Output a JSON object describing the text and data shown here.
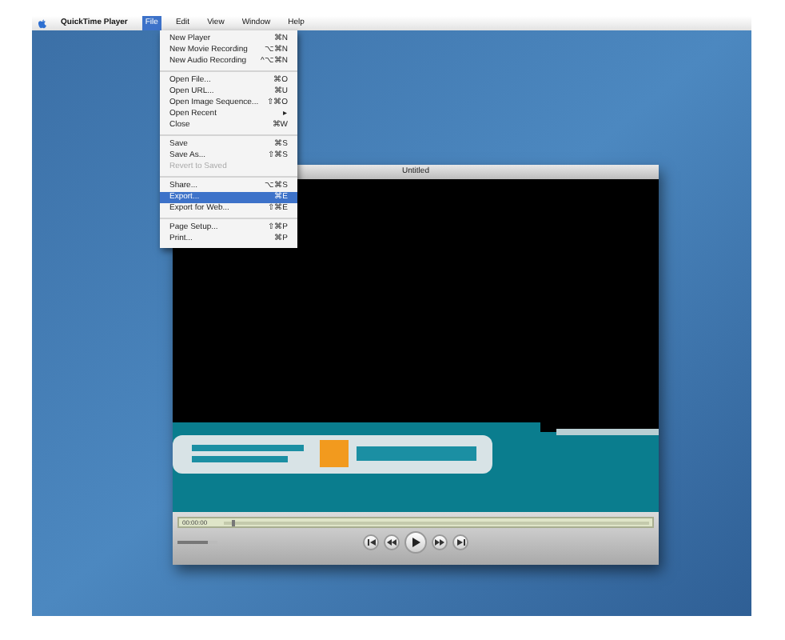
{
  "menu_bar": {
    "items": [
      {
        "kind": "app",
        "label": "QuickTime Player",
        "selected": false
      },
      {
        "kind": "menu",
        "label": "File",
        "selected": true
      },
      {
        "kind": "menu",
        "label": "Edit",
        "selected": false
      },
      {
        "kind": "menu",
        "label": "View",
        "selected": false
      },
      {
        "kind": "menu",
        "label": "Window",
        "selected": false
      },
      {
        "kind": "menu",
        "label": "Help",
        "selected": false
      }
    ]
  },
  "file_menu": {
    "items": [
      {
        "kind": "item",
        "label": "New Player",
        "shortcut": "⌘N",
        "disabled": false,
        "selected": false
      },
      {
        "kind": "item",
        "label": "New Movie Recording",
        "shortcut": "⌥⌘N",
        "disabled": false,
        "selected": false
      },
      {
        "kind": "item",
        "label": "New Audio Recording",
        "shortcut": "^⌥⌘N",
        "disabled": false,
        "selected": false
      },
      {
        "kind": "separator"
      },
      {
        "kind": "item",
        "label": "Open File...",
        "shortcut": "⌘O",
        "disabled": false,
        "selected": false
      },
      {
        "kind": "item",
        "label": "Open URL...",
        "shortcut": "⌘U",
        "disabled": false,
        "selected": false
      },
      {
        "kind": "item",
        "label": "Open Image Sequence...",
        "shortcut": "⇧⌘O",
        "disabled": false,
        "selected": false
      },
      {
        "kind": "item",
        "label": "Open Recent",
        "shortcut": "▸",
        "disabled": false,
        "selected": false
      },
      {
        "kind": "item",
        "label": "Close",
        "shortcut": "⌘W",
        "disabled": false,
        "selected": false
      },
      {
        "kind": "separator"
      },
      {
        "kind": "item",
        "label": "Save",
        "shortcut": "⌘S",
        "disabled": false,
        "selected": false
      },
      {
        "kind": "item",
        "label": "Save As...",
        "shortcut": "⇧⌘S",
        "disabled": false,
        "selected": false
      },
      {
        "kind": "item",
        "label": "Revert to Saved",
        "disabled": true,
        "selected": false
      },
      {
        "kind": "separator"
      },
      {
        "kind": "item",
        "label": "Share...",
        "shortcut": "⌥⌘S",
        "disabled": false,
        "selected": false
      },
      {
        "kind": "item",
        "label": "Export...",
        "shortcut": "⌘E",
        "disabled": false,
        "selected": true
      },
      {
        "kind": "item",
        "label": "Export for Web...",
        "shortcut": "⇧⌘E",
        "disabled": false,
        "selected": false
      },
      {
        "kind": "separator"
      },
      {
        "kind": "item",
        "label": "Page Setup...",
        "shortcut": "⇧⌘P",
        "disabled": false,
        "selected": false
      },
      {
        "kind": "item",
        "label": "Print...",
        "shortcut": "⌘P",
        "disabled": false,
        "selected": false
      }
    ]
  },
  "player": {
    "title": "Untitled",
    "time": "00:00:00",
    "progress": {
      "level": 0.02
    },
    "volume": {
      "level": 0.75
    }
  }
}
